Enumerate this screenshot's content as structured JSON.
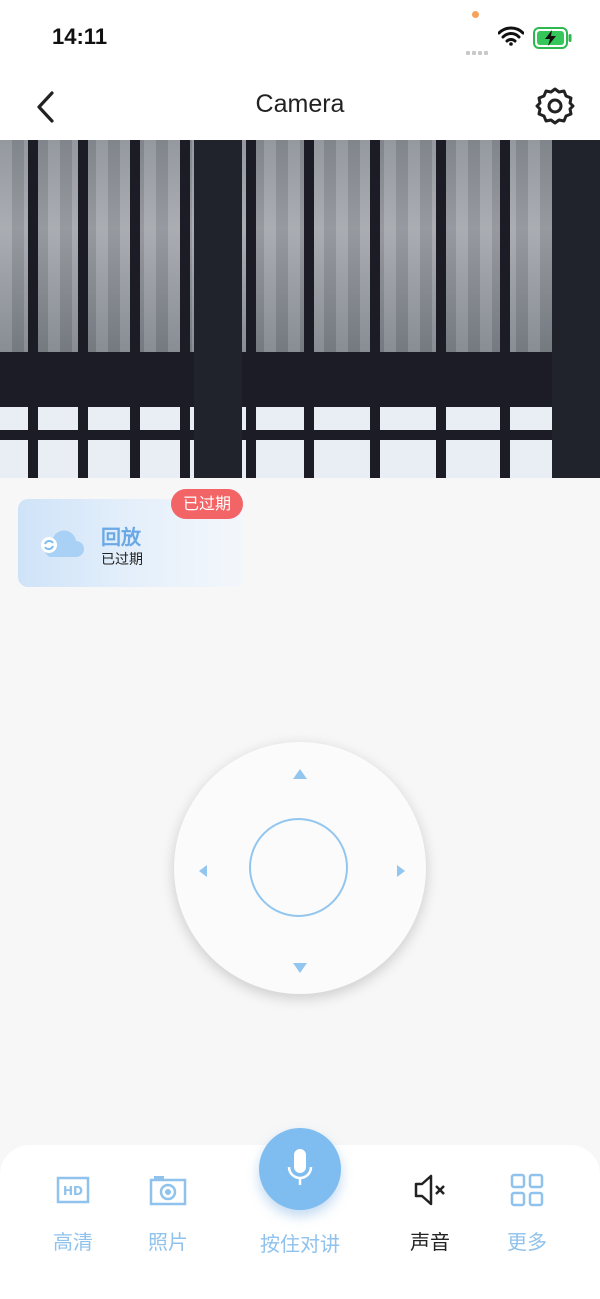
{
  "status_bar": {
    "time": "14:11"
  },
  "nav": {
    "title": "Camera"
  },
  "playback_card": {
    "title": "回放",
    "subtitle": "已过期",
    "badge": "已过期"
  },
  "toolbar": {
    "hd_label": "高清",
    "photo_label": "照片",
    "talk_label": "按住对讲",
    "sound_label": "声音",
    "more_label": "更多"
  },
  "colors": {
    "accent": "#7fbdf0",
    "badge": "#f26466",
    "muted_blue": "#8fc2ec"
  }
}
